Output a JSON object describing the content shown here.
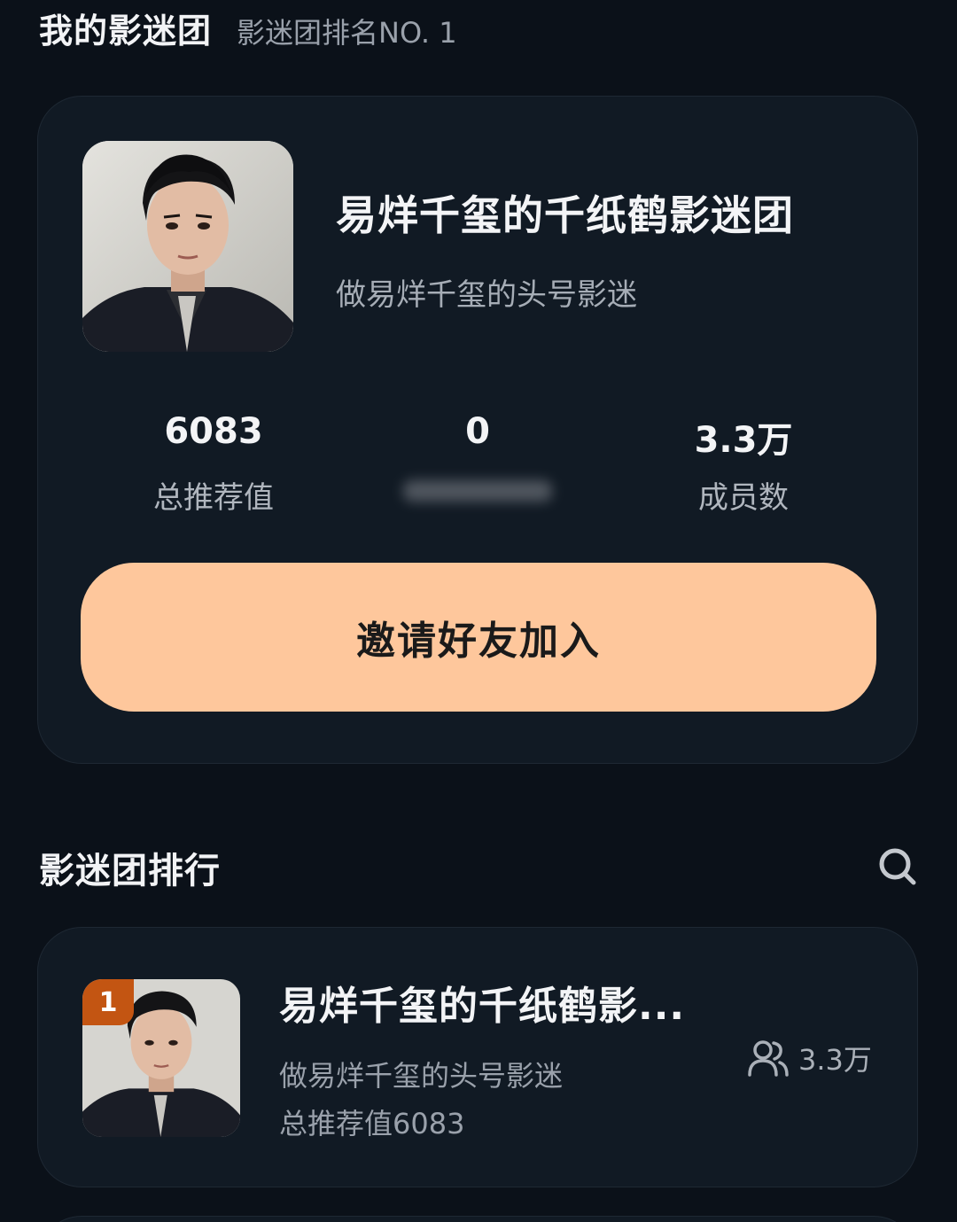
{
  "header": {
    "title": "我的影迷团",
    "rank_text": "影迷团排名NO. 1"
  },
  "my_club": {
    "name": "易烊千玺的千纸鹤影迷团",
    "slogan": "做易烊千玺的头号影迷",
    "stats": [
      {
        "value": "6083",
        "label": "总推荐值"
      },
      {
        "value": "0",
        "label": ""
      },
      {
        "value": "3.3万",
        "label": "成员数"
      }
    ],
    "invite_label": "邀请好友加入"
  },
  "ranking": {
    "title": "影迷团排行",
    "items": [
      {
        "rank": "1",
        "name": "易烊千玺的千纸鹤影...",
        "slogan": "做易烊千玺的头号影迷",
        "score_text": "总推荐值6083",
        "members": "3.3万"
      }
    ]
  },
  "colors": {
    "background": "#0b1119",
    "card": "#111a24",
    "accent_button": "#fec79c",
    "rank_badge": "#c35512"
  },
  "icons": [
    "search-icon",
    "members-icon",
    "avatar-photo"
  ]
}
